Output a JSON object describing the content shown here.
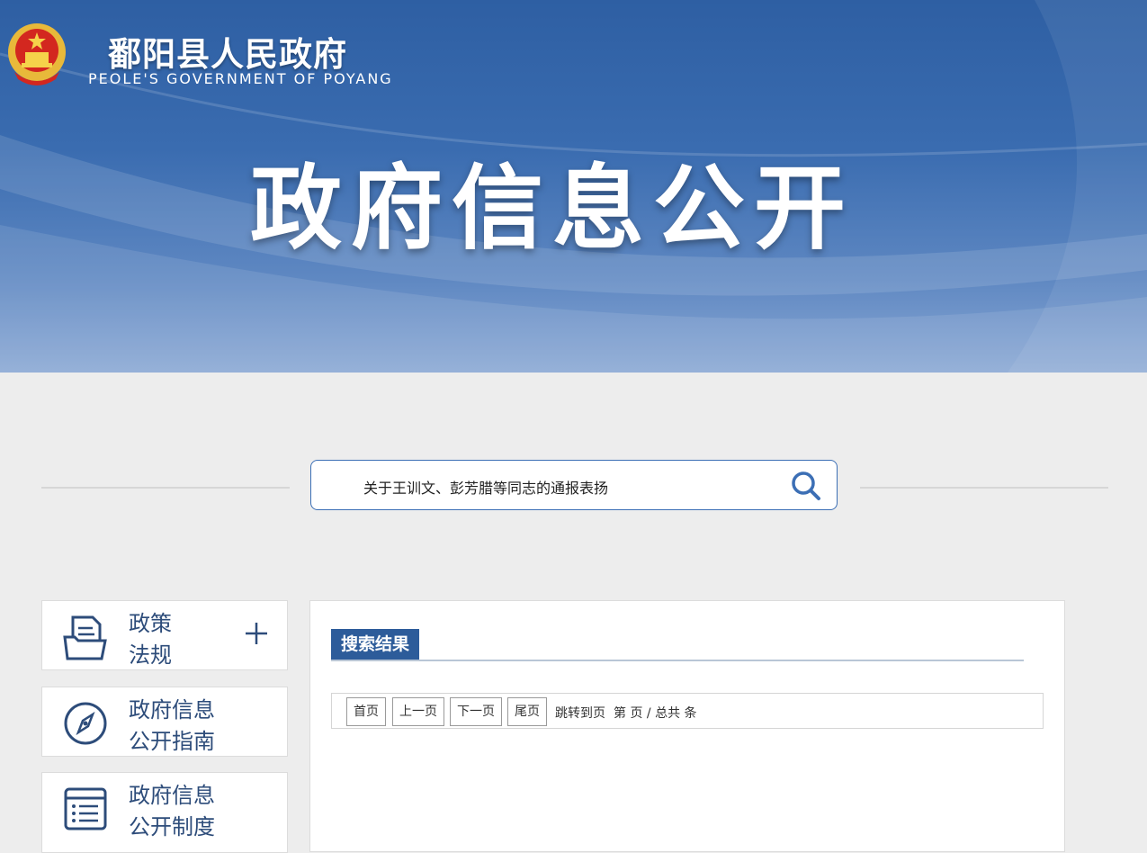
{
  "header": {
    "site_title": "鄱阳县人民政府",
    "site_subtitle": "PEOLE'S GOVERNMENT OF POYANG",
    "hero_title": "政府信息公开"
  },
  "search": {
    "value": "关于王训文、彭芳腊等同志的通报表扬"
  },
  "sidebar": {
    "items": [
      {
        "line1": "政策",
        "line2": "法规",
        "icon": "document-folder-icon",
        "expand": "plus-icon"
      },
      {
        "line1": "政府信息",
        "line2": "公开指南",
        "icon": "compass-icon"
      },
      {
        "line1": "政府信息",
        "line2": "公开制度",
        "icon": "list-icon"
      }
    ]
  },
  "results": {
    "tab_title": "搜索结果"
  },
  "pager": {
    "first": "首页",
    "prev": "上一页",
    "next": "下一页",
    "last": "尾页",
    "jump_text": "跳转到页",
    "page_info": "第 页 / 总共 条"
  },
  "colors": {
    "banner": "#2e5fa3",
    "accent": "#2d5c9a",
    "sidebar_text": "#2d4c7a"
  }
}
